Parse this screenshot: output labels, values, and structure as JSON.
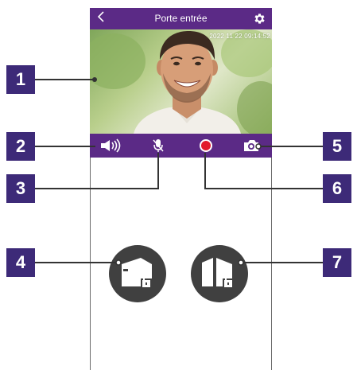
{
  "header": {
    "title": "Porte entrée",
    "back_icon": "chevron-left-icon",
    "settings_icon": "gear-icon"
  },
  "video": {
    "timestamp": "2022 11 22 09:14:52"
  },
  "controls": [
    {
      "name": "speaker-volume",
      "icon": "speaker-volume-icon"
    },
    {
      "name": "microphone",
      "icon": "microphone-icon"
    },
    {
      "name": "record",
      "icon": "record-icon"
    },
    {
      "name": "snapshot",
      "icon": "camera-icon"
    }
  ],
  "door_buttons": [
    {
      "name": "unlock-gate",
      "icon": "gate-unlock-icon"
    },
    {
      "name": "unlock-door",
      "icon": "door-unlock-icon"
    }
  ],
  "callouts": [
    "1",
    "2",
    "3",
    "4",
    "5",
    "6",
    "7"
  ],
  "colors": {
    "primary": "#5b2a86",
    "callout": "#3d2a78",
    "button": "#404040",
    "record": "#e21a2c"
  }
}
